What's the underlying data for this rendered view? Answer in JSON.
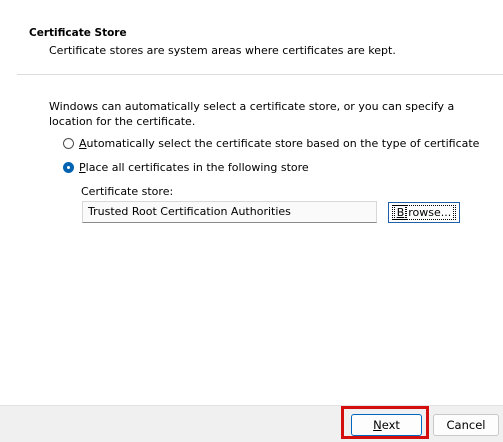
{
  "header": {
    "title": "Certificate Store",
    "description": "Certificate stores are system areas where certificates are kept."
  },
  "intro_text": "Windows can automatically select a certificate store, or you can specify a location for the certificate.",
  "options": {
    "auto": {
      "mnemonic": "A",
      "rest": "utomatically select the certificate store based on the type of certificate",
      "checked": false
    },
    "place": {
      "mnemonic": "P",
      "rest": "lace all certificates in the following store",
      "checked": true
    }
  },
  "store": {
    "label": "Certificate store:",
    "value": "Trusted Root Certification Authorities",
    "browse_mnemonic": "B",
    "browse_rest": "rowse..."
  },
  "footer": {
    "next_mnemonic": "N",
    "next_rest": "ext",
    "cancel_label": "Cancel"
  },
  "colors": {
    "accent": "#0063b1",
    "highlight": "#d40d0d"
  }
}
